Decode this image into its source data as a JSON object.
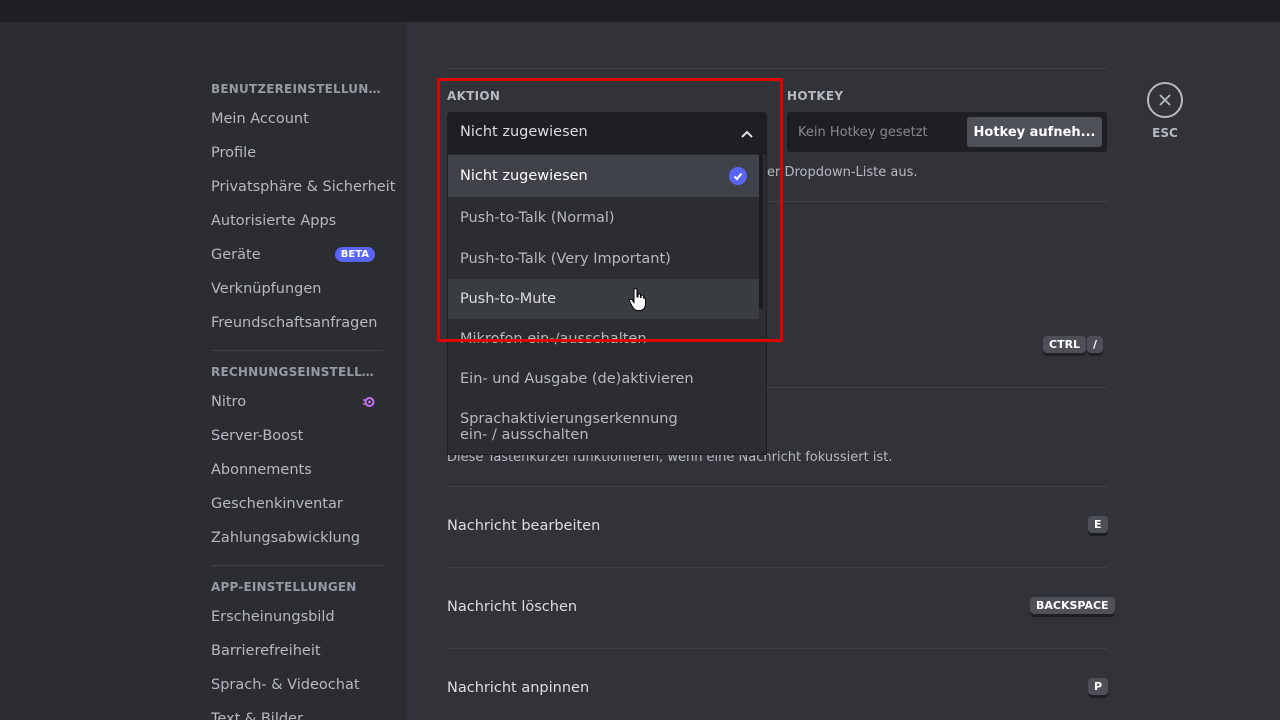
{
  "sidebar": {
    "sections": [
      {
        "header": "BENUTZEREINSTELLUNGEN",
        "items": [
          {
            "label": "Mein Account"
          },
          {
            "label": "Profile"
          },
          {
            "label": "Privatsphäre & Sicherheit"
          },
          {
            "label": "Autorisierte Apps"
          },
          {
            "label": "Geräte",
            "badge": "BETA"
          },
          {
            "label": "Verknüpfungen"
          },
          {
            "label": "Freundschaftsanfragen"
          }
        ]
      },
      {
        "header": "RECHNUNGSEINSTELLUNG...",
        "items": [
          {
            "label": "Nitro",
            "icon": "nitro-icon"
          },
          {
            "label": "Server-Boost"
          },
          {
            "label": "Abonnements"
          },
          {
            "label": "Geschenkinventar"
          },
          {
            "label": "Zahlungsabwicklung"
          }
        ]
      },
      {
        "header": "APP-EINSTELLUNGEN",
        "items": [
          {
            "label": "Erscheinungsbild"
          },
          {
            "label": "Barrierefreiheit"
          },
          {
            "label": "Sprach- & Videochat"
          },
          {
            "label": "Text & Bilder"
          }
        ]
      }
    ]
  },
  "keybind_editor": {
    "action_label": "AKTION",
    "hotkey_label": "HOTKEY",
    "selected_action": "Nicht zugewiesen",
    "hotkey_placeholder": "Kein Hotkey gesetzt",
    "record_button": "Hotkey aufneh...",
    "hint_partial": "er Dropdown-Liste aus.",
    "options": [
      {
        "label": "Nicht zugewiesen",
        "selected": true
      },
      {
        "label": "Push-to-Talk (Normal)"
      },
      {
        "label": "Push-to-Talk (Very Important)"
      },
      {
        "label": "Push-to-Mute",
        "hovered": true
      },
      {
        "label": "Mikrofon ein-/ausschalten"
      },
      {
        "label": "Ein- und Ausgabe (de)aktivieren"
      },
      {
        "label": "Sprachaktivierungserkennung ein- / ausschalten"
      }
    ]
  },
  "shortcut_keys_row": [
    "CTRL",
    "/"
  ],
  "message_hint": "Diese Tastenkürzel funktionieren, wenn eine Nachricht fokussiert ist.",
  "message_shortcuts": [
    {
      "label": "Nachricht bearbeiten",
      "key": "E"
    },
    {
      "label": "Nachricht löschen",
      "key": "BACKSPACE"
    },
    {
      "label": "Nachricht anpinnen",
      "key": "P"
    }
  ],
  "close": {
    "label": "ESC"
  },
  "colors": {
    "accent": "#5865f2",
    "highlight": "#e00000",
    "background": "#313338",
    "sidebar": "#2b2d31"
  }
}
